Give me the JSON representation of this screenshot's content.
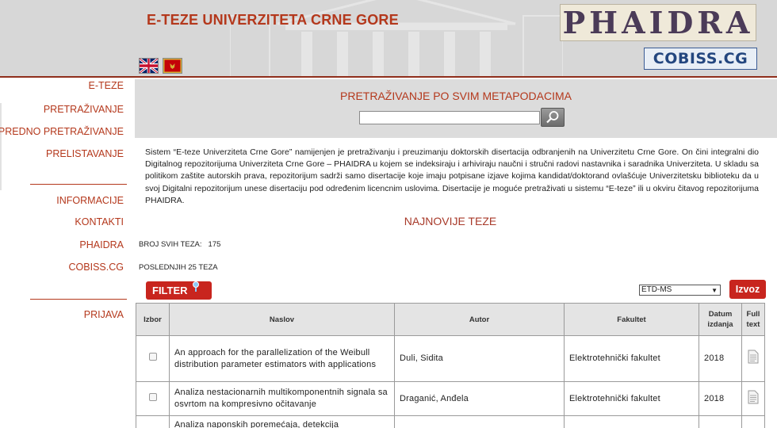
{
  "header": {
    "site_title": "E-TEZE UNIVERZITETA CRNE GORE",
    "phaidra_logo": "PHAIDRA",
    "cobiss_logo": "COBISS.CG"
  },
  "sidebar": {
    "items": [
      {
        "label": "E-TEZE"
      },
      {
        "label": "PRETRAŽIVANJE"
      },
      {
        "label": "NAPREDNO PRETRAŽIVANJE"
      },
      {
        "label": "PRELISTAVANJE"
      },
      {
        "label": "INFORMACIJE"
      },
      {
        "label": "KONTAKTI"
      },
      {
        "label": "PHAIDRA"
      },
      {
        "label": "COBISS.CG"
      },
      {
        "label": "PRIJAVA"
      }
    ]
  },
  "search": {
    "title": "PRETRAŽIVANJE PO SVIM METAPODACIMA",
    "value": ""
  },
  "intro": "Sistem “E-teze Univerziteta Crne Gore” namijenjen je pretraživanju i preuzimanju doktorskih disertacija odbranjenih na Univerzitetu Crne Gore. On čini integralni dio Digitalnog repozitorijuma Univerziteta Crne Gore – PHAIDRA u kojem se indeksiraju i arhiviraju naučni i stručni radovi nastavnika i saradnika Univerziteta. U skladu sa politikom zaštite autorskih prava, repozitorijum sadrži samo disertacije koje imaju potpisane izjave kojima kandidat/doktorand ovlašćuje Univerzitetsku biblioteku da u svoj Digitalni repozitorijum unese disertaciju pod određenim licencnim uslovima. Disertacije je moguće pretraživati u sistemu “E-teze” ili u okviru čitavog repozitorijuma PHAIDRA.",
  "latest": {
    "title": "NAJNOVIJE TEZE",
    "total_label": "BROJ SVIH TEZA:",
    "total_value": "175",
    "recent_label": "POSLEDNJIH",
    "recent_count": "25",
    "recent_suffix": "TEZA"
  },
  "toolbar": {
    "filter_label": "FILTER",
    "format_value": "ETD-MS",
    "export_label": "Izvoz"
  },
  "table": {
    "headers": [
      "Izbor",
      "Naslov",
      "Autor",
      "Fakultet",
      "Datum izdanja",
      "Full text"
    ],
    "rows": [
      {
        "title": "An approach for the parallelization of the Weibull distribution parameter estimators with applications",
        "author": "Duli, Sidita",
        "faculty": "Elektrotehnički fakultet",
        "year": "2018"
      },
      {
        "title": "Analiza nestacionarnih multikomponentnih signala sa osvrtom na kompresivno očitavanje",
        "author": "Draganić, Anđela",
        "faculty": "Elektrotehnički fakultet",
        "year": "2018"
      },
      {
        "title": "Analiza naponskih poremećaja, detekcija",
        "author": "",
        "faculty": "",
        "year": ""
      }
    ]
  },
  "colors": {
    "accent": "#b4381c",
    "button_red": "#c8251e",
    "panel_gray": "#dcdcdc",
    "header_gray": "#d7d7d7"
  },
  "icons": [
    "uk-flag-icon",
    "montenegro-flag-icon",
    "search-icon",
    "filter-info-icon",
    "dropdown-arrow-icon",
    "document-icon"
  ]
}
